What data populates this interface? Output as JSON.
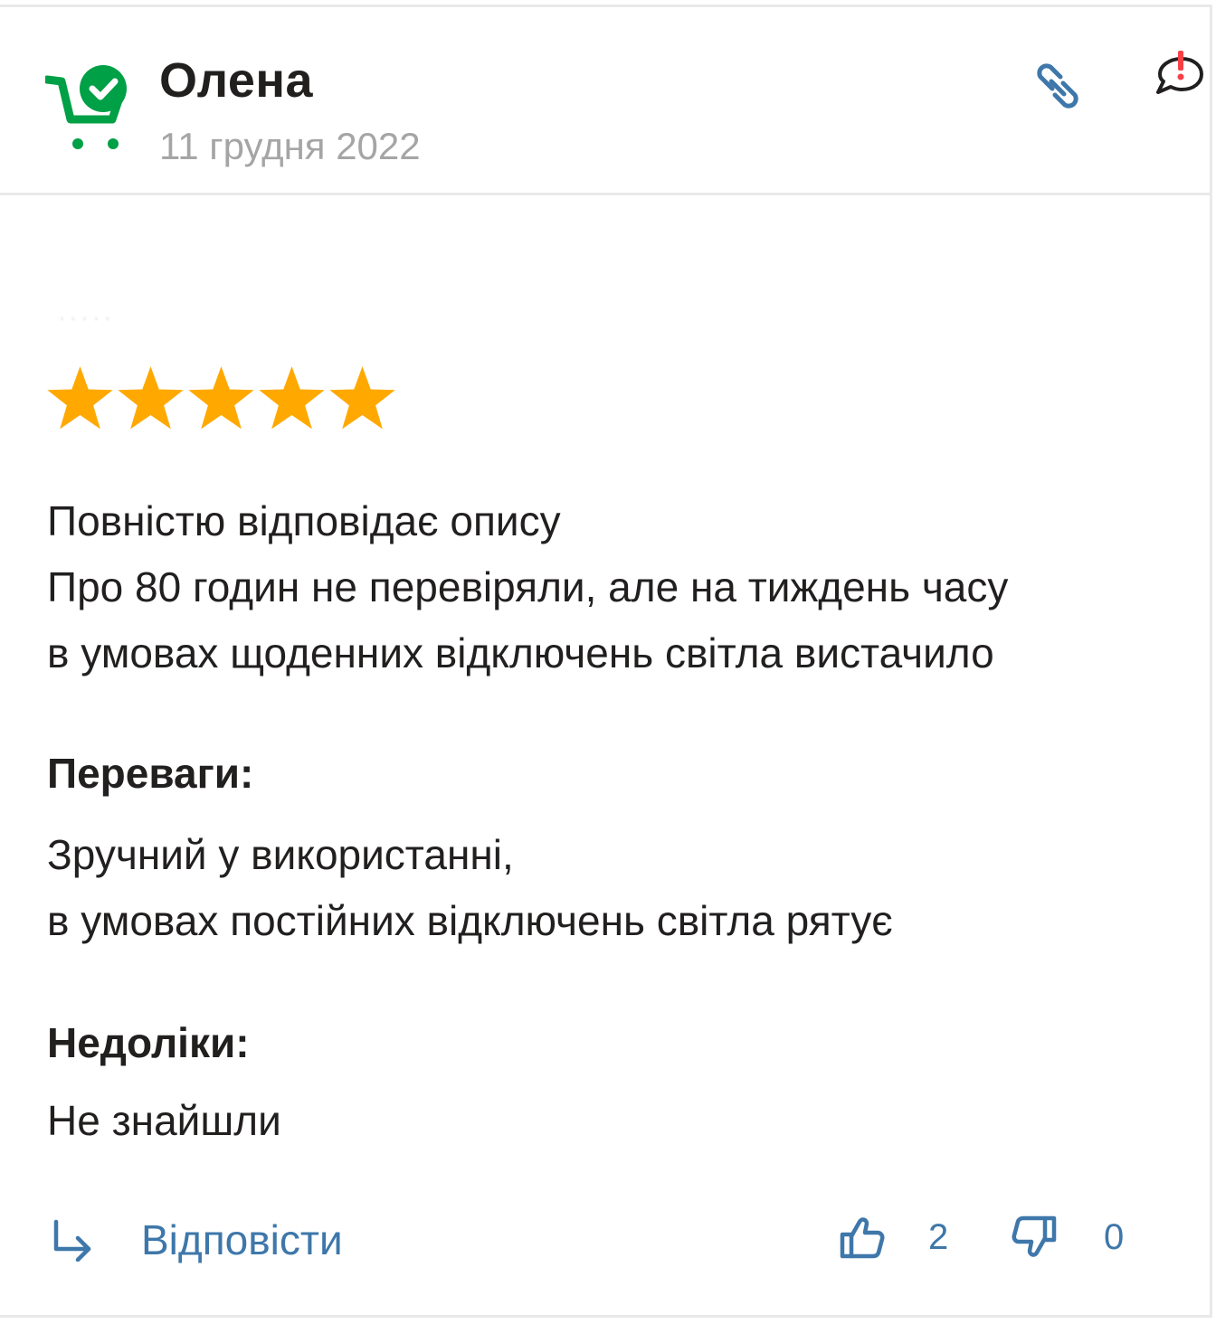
{
  "review": {
    "author": "Олена",
    "date": "11 грудня 2022",
    "rating": 5,
    "rating_max": 5,
    "faint_text": "·····",
    "body_lines": [
      "Повністю відповідає опису",
      "Про 80 годин не перевіряли, але на тиждень часу",
      "в умовах щоденних відключень світла вистачило"
    ],
    "pros_title": "Переваги:",
    "pros_lines": [
      "Зручний у використанні,",
      "в умовах постійних відключень світла рятує"
    ],
    "cons_title": "Недоліки:",
    "cons_lines": [
      "Не знайшли"
    ]
  },
  "actions": {
    "reply_label": "Відповісти",
    "likes": "2",
    "dislikes": "0"
  },
  "icons": {
    "badge": "verified-buyer-cart-icon",
    "link": "link-icon",
    "report": "report-icon",
    "reply": "reply-arrow-icon",
    "like": "thumbs-up-icon",
    "dislike": "thumbs-down-icon"
  },
  "colors": {
    "accent_blue": "#3e77aa",
    "star": "#ffa900",
    "badge_green": "#00a046",
    "report_red": "#f84147",
    "text": "#221f1f",
    "muted": "#a6a5a5"
  }
}
